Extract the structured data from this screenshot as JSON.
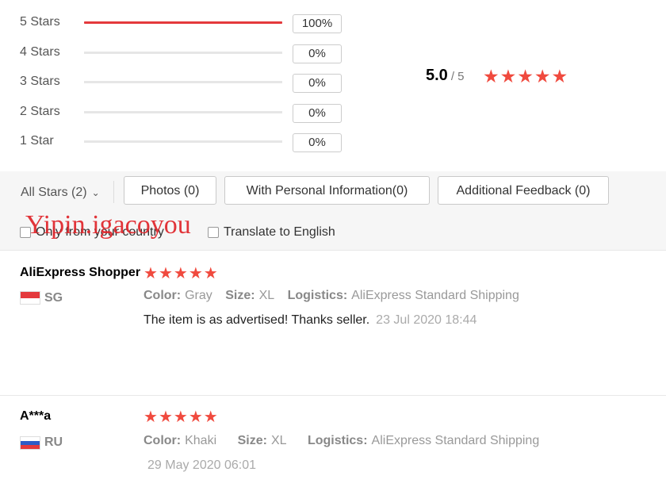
{
  "distribution": [
    {
      "label": "5 Stars",
      "percent": "100%",
      "fill": 1.0
    },
    {
      "label": "4 Stars",
      "percent": "0%",
      "fill": 0
    },
    {
      "label": "3 Stars",
      "percent": "0%",
      "fill": 0
    },
    {
      "label": "2 Stars",
      "percent": "0%",
      "fill": 0
    },
    {
      "label": "1 Star",
      "percent": "0%",
      "fill": 0
    }
  ],
  "overall": {
    "score": "5.0",
    "out_of": "/ 5",
    "stars": 5
  },
  "filters": {
    "all_stars": "All Stars (2)",
    "photos": "Photos (0)",
    "personal_info": "With Personal Information(0)",
    "additional": "Additional Feedback (0)",
    "only_country": "Only from your country",
    "translate": "Translate to English"
  },
  "watermark": "Yipin.igacoyou",
  "colors": {
    "accent": "#e4393c",
    "star": "#f04a3e"
  },
  "reviews": [
    {
      "name": "AliExpress Shopper",
      "stars": 5,
      "country": "SG",
      "color_label": "Color:",
      "color": "Gray",
      "size_label": "Size:",
      "size": "XL",
      "logistics_label": "Logistics:",
      "logistics": "AliExpress Standard Shipping",
      "text": "The item is as advertised! Thanks seller.",
      "date": "23 Jul 2020 18:44"
    },
    {
      "name": "A***a",
      "stars": 5,
      "country": "RU",
      "color_label": "Color:",
      "color": "Khaki",
      "size_label": "Size:",
      "size": "XL",
      "logistics_label": "Logistics:",
      "logistics": "AliExpress Standard Shipping",
      "text": "",
      "date": "29 May 2020 06:01"
    }
  ]
}
